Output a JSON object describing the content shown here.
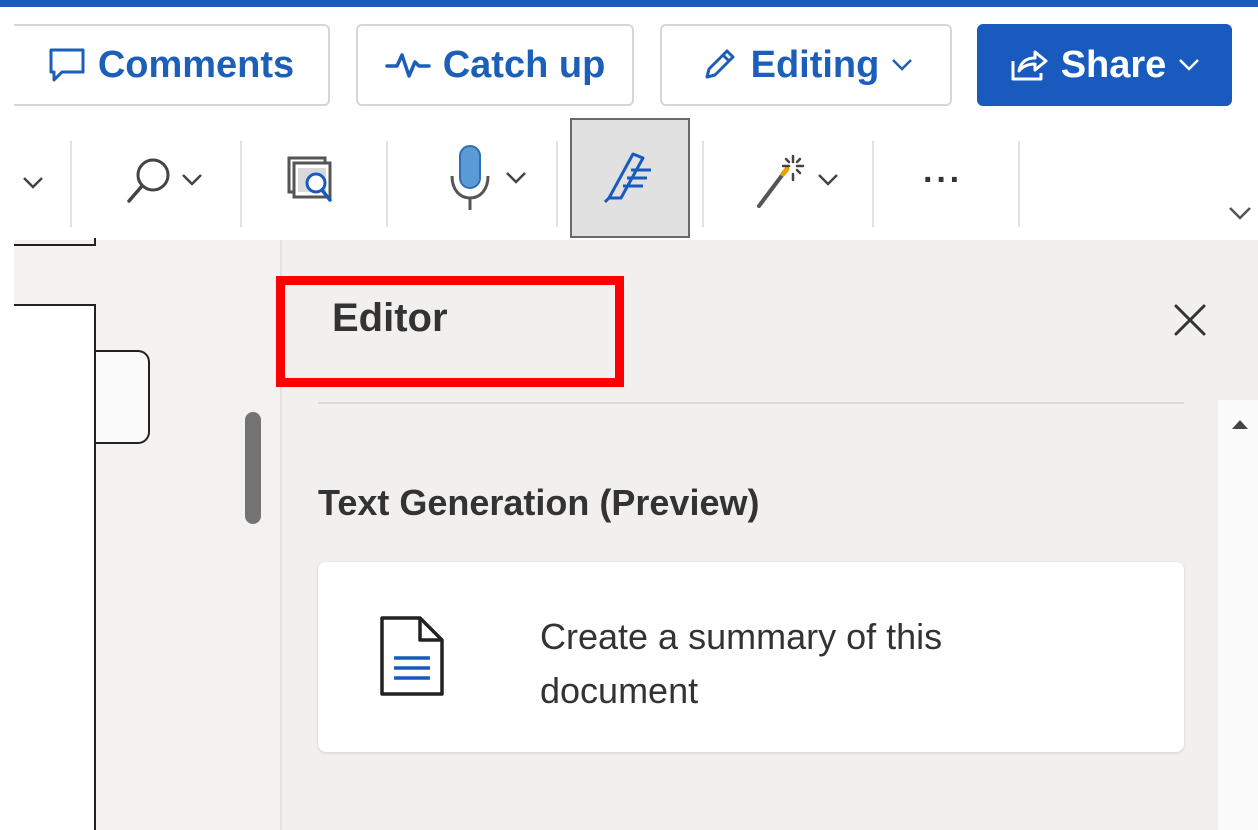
{
  "header": {
    "comments_label": "Comments",
    "catchup_label": "Catch up",
    "editing_label": "Editing",
    "share_label": "Share"
  },
  "ribbon": {
    "more_label": "···"
  },
  "editor_pane": {
    "title": "Editor",
    "section_title": "Text Generation (Preview)",
    "card_text": "Create a summary of this document"
  },
  "colors": {
    "accent": "#185abd",
    "highlight": "#ff0000",
    "pane_background": "#f1f0ef"
  },
  "icons": {
    "comments": "comment-icon",
    "catchup": "activity-icon",
    "editing": "pencil-icon",
    "share": "share-icon",
    "find": "search-icon",
    "reuse": "reuse-files-icon",
    "dictate": "microphone-icon",
    "editor": "editor-icon",
    "designer": "magic-wand-icon",
    "close": "close-icon",
    "card": "document-icon"
  }
}
